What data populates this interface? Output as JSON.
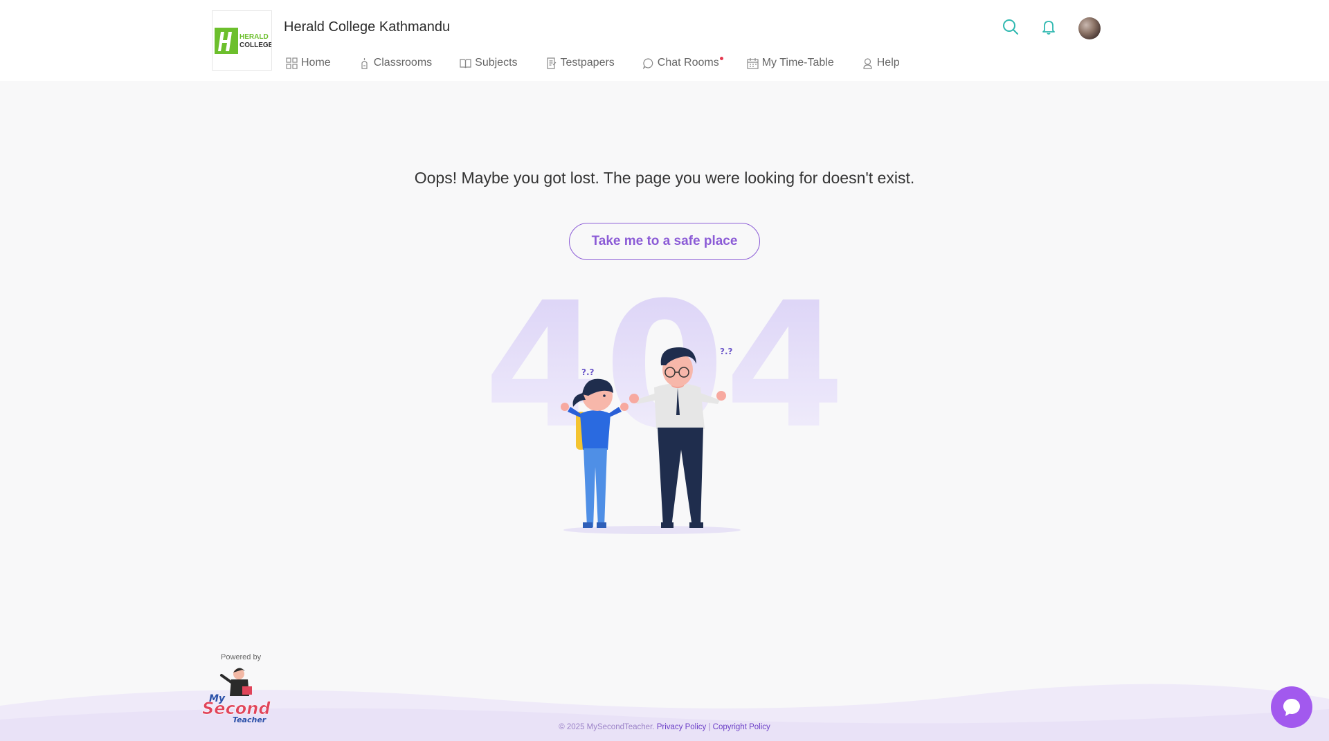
{
  "header": {
    "school_name": "Herald College Kathmandu",
    "logo_text_top": "HERALD",
    "logo_text_bottom": "COLLEGE",
    "nav": [
      {
        "label": "Home",
        "icon": "grid-icon"
      },
      {
        "label": "Classrooms",
        "icon": "classroom-icon"
      },
      {
        "label": "Subjects",
        "icon": "book-icon"
      },
      {
        "label": "Testpapers",
        "icon": "testpaper-icon"
      },
      {
        "label": "Chat Rooms",
        "icon": "chat-icon",
        "has_notification_dot": true
      },
      {
        "label": "My Time-Table",
        "icon": "calendar-icon"
      },
      {
        "label": "Help",
        "icon": "help-icon"
      }
    ],
    "icons": [
      "search-icon",
      "bell-icon",
      "avatar"
    ]
  },
  "main": {
    "message": "Oops! Maybe you got lost. The page you were looking for doesn't exist.",
    "button_label": "Take me to a safe place",
    "big_number": "404"
  },
  "footer": {
    "powered_by": "Powered by",
    "brand_line1": "My",
    "brand_line2": "Second",
    "brand_line3": "Teacher",
    "copyright": "© 2025 MySecondTeacher.",
    "privacy": "Privacy Policy",
    "separator": "|",
    "copyright_policy": "Copyright Policy"
  },
  "colors": {
    "accent_purple": "#8b5bd6",
    "teal_icon": "#2fb8b0",
    "chat_button": "#a259ee",
    "notification_dot": "#e53950"
  }
}
